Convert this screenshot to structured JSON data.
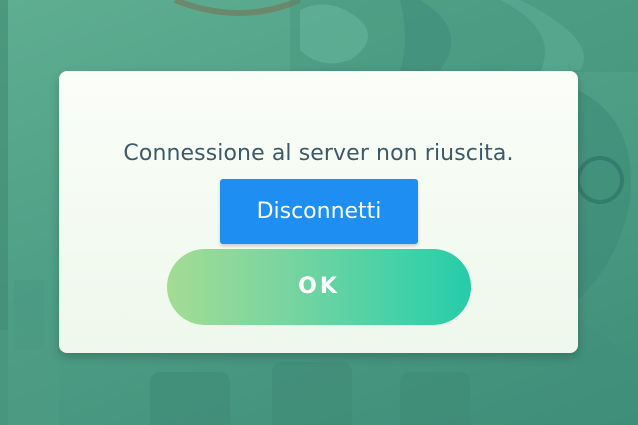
{
  "dialog": {
    "message": "Connessione al server non riuscita.",
    "disconnect_label": "Disconnetti",
    "ok_label": "OK"
  },
  "colors": {
    "background_green": "#4f9f86",
    "dialog_background": "#f4faf2",
    "message_text": "#3e5a66",
    "disconnect_button": "#1e8ef2",
    "ok_gradient_start": "#a4dc94",
    "ok_gradient_end": "#26cca9"
  }
}
